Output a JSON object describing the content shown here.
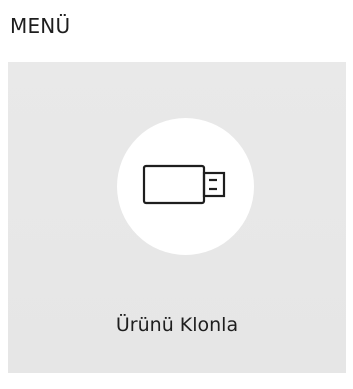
{
  "header": {
    "title": "MENÜ"
  },
  "menu_item": {
    "icon": "usb-drive-icon",
    "label": "Ürünü Klonla"
  },
  "colors": {
    "tile_background": "#e8e8e8",
    "icon_circle": "#ffffff",
    "text": "#1e1e1e"
  }
}
